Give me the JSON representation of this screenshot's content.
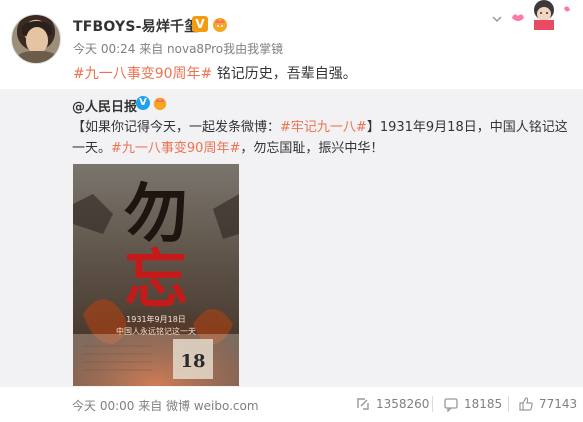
{
  "post": {
    "username": "TFBOYS-易烊千玺",
    "verified_badge": "V",
    "meta": "今天 00:24 来自 nova8Pro我由我掌镜",
    "hashtag": "#九一八事变90周年#",
    "text_after_hashtag": " 铭记历史，吾辈自强。"
  },
  "repost": {
    "author": "@人民日报",
    "text_seg1": "【如果你记得今天，一起发条微博：",
    "tag1": "#牢记九一八#",
    "text_seg2": "】1931年9月18日，中国人铭记这一天。",
    "tag2": "#九一八事变90周年#",
    "text_seg3": "，勿忘国耻，振兴中华！",
    "poster": {
      "char_top": "勿",
      "char_bottom": "忘",
      "date_line": "1931年9月18日",
      "subtitle": "中国人永远铭记这一天",
      "calendar_num": "18"
    },
    "footer": {
      "meta": "今天 00:00 来自 微博 weibo.com",
      "reposts": "1358260",
      "comments": "18185",
      "likes": "77143"
    }
  },
  "colors": {
    "hashtag": "#eb7350",
    "meta": "#808080",
    "repost_bg": "#f2f2f5"
  },
  "icons": [
    "chevron-down-icon",
    "verified-v-icon",
    "crown-icon",
    "blue-verified-icon",
    "repost-icon",
    "comment-icon",
    "like-icon"
  ]
}
